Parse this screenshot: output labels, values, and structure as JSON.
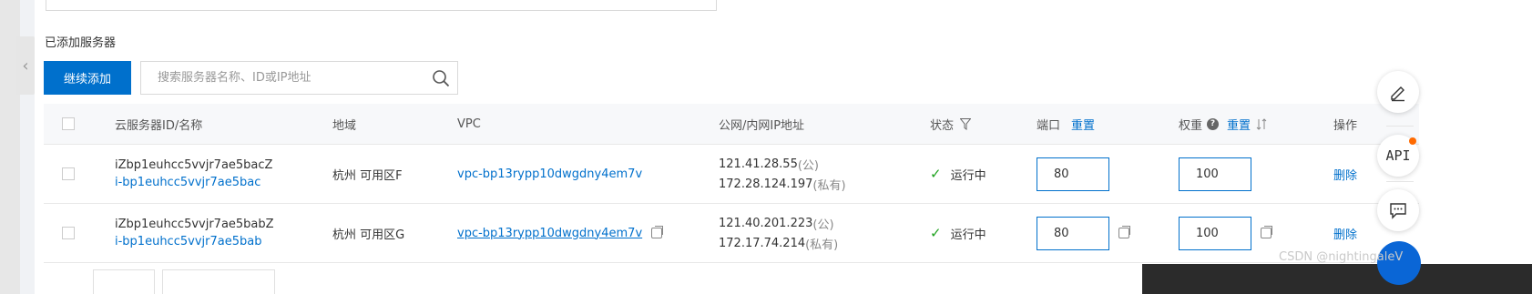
{
  "section_title": "已添加服务器",
  "continue_add_label": "继续添加",
  "search": {
    "placeholder": "搜索服务器名称、ID或IP地址",
    "value": ""
  },
  "columns": {
    "server": "云服务器ID/名称",
    "region": "地域",
    "vpc": "VPC",
    "ip": "公网/内网IP地址",
    "status": "状态",
    "port": "端口",
    "port_reset": "重置",
    "weight": "权重",
    "weight_reset": "重置",
    "action": "操作"
  },
  "rows": [
    {
      "name": "iZbp1euhcc5vvjr7ae5bacZ",
      "id": "i-bp1euhcc5vvjr7ae5bac",
      "region": "杭州 可用区F",
      "vpc": "vpc-bp13rypp10dwgdny4em7v",
      "public_ip": "121.41.28.55",
      "public_tag": "(公)",
      "private_ip": "172.28.124.197",
      "private_tag": "(私有)",
      "status": "运行中",
      "port": "80",
      "weight": "100",
      "action": "删除"
    },
    {
      "name": "iZbp1euhcc5vvjr7ae5babZ",
      "id": "i-bp1euhcc5vvjr7ae5bab",
      "region": "杭州 可用区G",
      "vpc": "vpc-bp13rypp10dwgdny4em7v",
      "public_ip": "121.40.201.223",
      "public_tag": "(公)",
      "private_ip": "172.17.74.214",
      "private_tag": "(私有)",
      "status": "运行中",
      "port": "80",
      "weight": "100",
      "action": "删除"
    }
  ],
  "rail": {
    "api_label": "API"
  },
  "watermark": "CSDN @nightingaleV",
  "colors": {
    "primary": "#0070cc",
    "status_ok": "#1fa21f",
    "badge": "#ff6a00"
  }
}
